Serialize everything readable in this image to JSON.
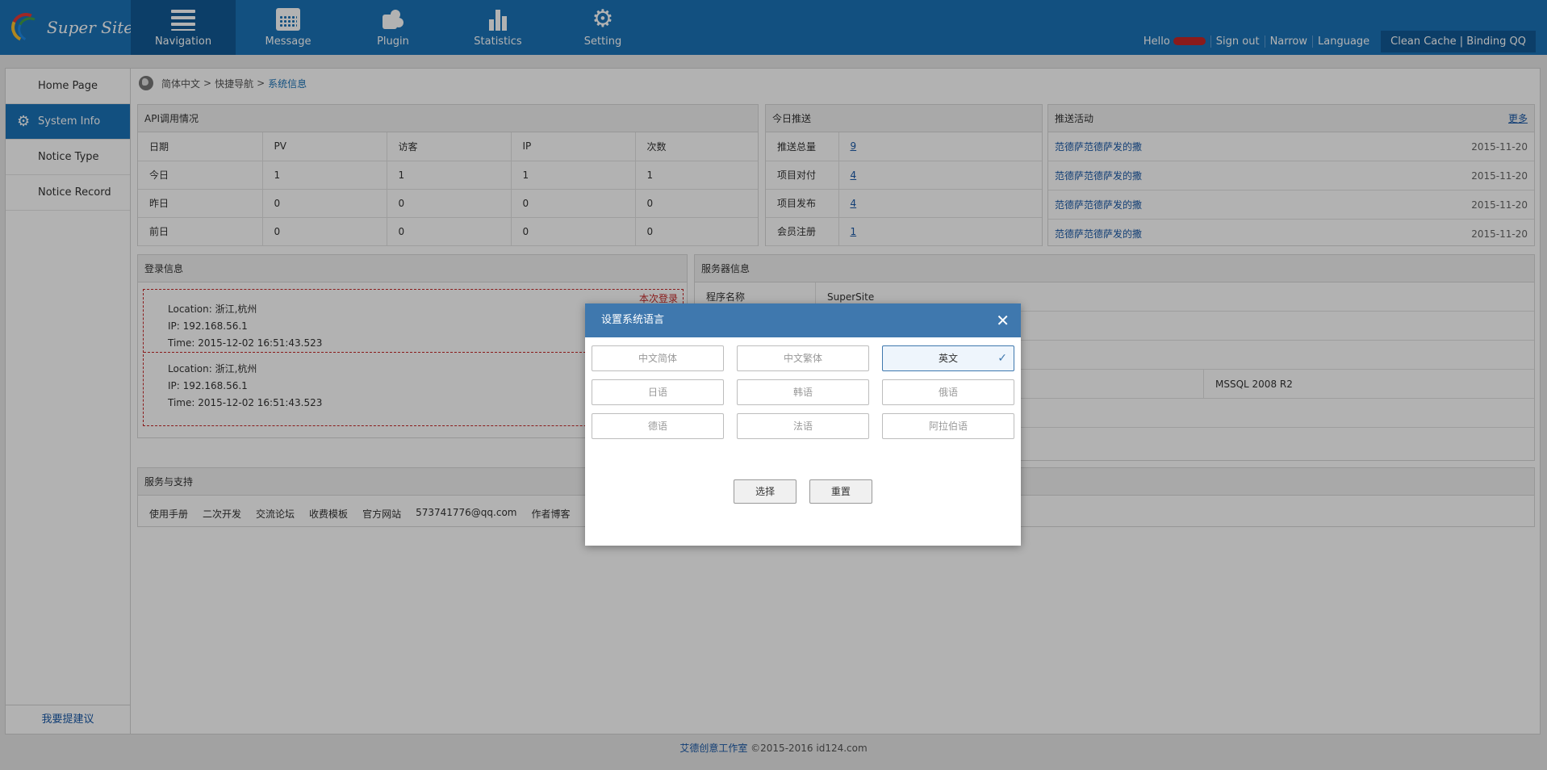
{
  "header": {
    "logo_text": "Super Site",
    "tabs": [
      {
        "label": "Navigation",
        "icon": "list-icon"
      },
      {
        "label": "Message",
        "icon": "calendar-icon"
      },
      {
        "label": "Plugin",
        "icon": "puzzle-icon"
      },
      {
        "label": "Statistics",
        "icon": "bar-chart-icon"
      },
      {
        "label": "Setting",
        "icon": "gear-icon"
      }
    ],
    "hello": "Hello",
    "sign_out": "Sign out",
    "narrow": "Narrow",
    "language": "Language",
    "clean_cache": "Clean Cache | Binding QQ"
  },
  "sidebar": {
    "items": [
      {
        "label": "Home Page"
      },
      {
        "label": "System Info"
      },
      {
        "label": "Notice Type"
      },
      {
        "label": "Notice Record"
      }
    ],
    "footer": "我要提建议"
  },
  "breadcrumb": {
    "a": "简体中文",
    "sep": ">",
    "b": "快捷导航",
    "c": "系统信息"
  },
  "api": {
    "title": "API调用情况",
    "headers": [
      "日期",
      "PV",
      "访客",
      "IP",
      "次数"
    ],
    "rows": [
      [
        "今日",
        "1",
        "1",
        "1",
        "1"
      ],
      [
        "昨日",
        "0",
        "0",
        "0",
        "0"
      ],
      [
        "前日",
        "0",
        "0",
        "0",
        "0"
      ]
    ]
  },
  "push_today": {
    "title": "今日推送",
    "rows": [
      {
        "k": "推送总量",
        "v": "9"
      },
      {
        "k": "项目对付",
        "v": "4"
      },
      {
        "k": "项目发布",
        "v": "4"
      },
      {
        "k": "会员注册",
        "v": "1"
      }
    ]
  },
  "push_activity": {
    "title": "推送活动",
    "more": "更多",
    "items": [
      {
        "title": "范德萨范德萨发的撒",
        "date": "2015-11-20"
      },
      {
        "title": "范德萨范德萨发的撒",
        "date": "2015-11-20"
      },
      {
        "title": "范德萨范德萨发的撒",
        "date": "2015-11-20"
      },
      {
        "title": "范德萨范德萨发的撒",
        "date": "2015-11-20"
      }
    ]
  },
  "login": {
    "title": "登录信息",
    "tag": "本次登录",
    "entries": [
      {
        "location": "Location: 浙江,杭州",
        "ip": "IP: 192.168.56.1",
        "time": "Time: 2015-12-02 16:51:43.523"
      },
      {
        "location": "Location: 浙江,杭州",
        "ip": "IP: 192.168.56.1",
        "time": "Time: 2015-12-02 16:51:43.523"
      }
    ]
  },
  "server": {
    "title": "服务器信息",
    "program_label": "程序名称",
    "program_value": "SuperSite",
    "db_value": "MSSQL 2008 R2"
  },
  "support": {
    "title": "服务与支持",
    "links": [
      "使用手册",
      "二次开发",
      "交流论坛",
      "收费模板",
      "官方网站",
      "573741776@qq.com",
      "作者博客"
    ]
  },
  "footer": {
    "brand": "艾德创意工作室",
    "copy": "©2015-2016 id124.com"
  },
  "modal": {
    "title": "设置系统语言",
    "close": "✕",
    "languages": [
      {
        "label": "中文简体",
        "selected": false
      },
      {
        "label": "中文繁体",
        "selected": false
      },
      {
        "label": "英文",
        "selected": true
      },
      {
        "label": "日语",
        "selected": false
      },
      {
        "label": "韩语",
        "selected": false
      },
      {
        "label": "俄语",
        "selected": false
      },
      {
        "label": "德语",
        "selected": false
      },
      {
        "label": "法语",
        "selected": false
      },
      {
        "label": "阿拉伯语",
        "selected": false
      }
    ],
    "check": "✓",
    "select_label": "选择",
    "reset_label": "重置"
  }
}
